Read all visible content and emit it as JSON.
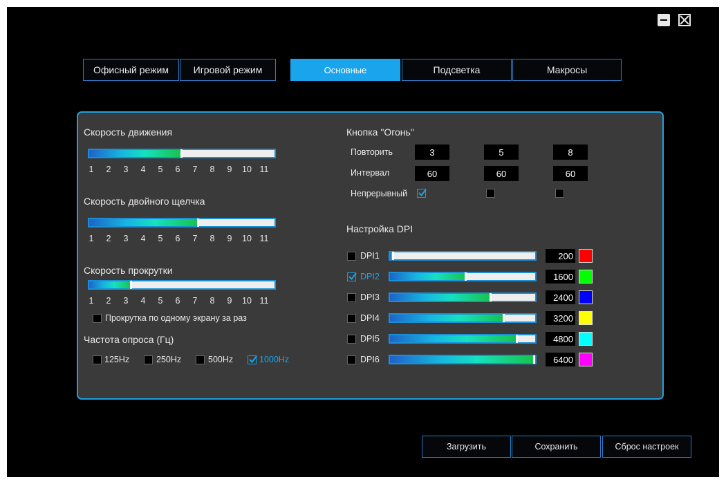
{
  "window": {
    "minimize_icon": "minimize-icon",
    "close_icon": "close-icon"
  },
  "mode_tabs": [
    {
      "label": "Офисный режим"
    },
    {
      "label": "Игровой режим"
    }
  ],
  "section_tabs": [
    {
      "label": "Основные",
      "active": true
    },
    {
      "label": "Подсветка",
      "active": false
    },
    {
      "label": "Макросы",
      "active": false
    }
  ],
  "ticks": [
    "1",
    "2",
    "3",
    "4",
    "5",
    "6",
    "7",
    "8",
    "9",
    "10",
    "11"
  ],
  "movement": {
    "title": "Скорость движения",
    "value": 6
  },
  "double_click": {
    "title": "Скорость двойного щелчка",
    "value": 7
  },
  "scroll": {
    "title": "Скорость прокрутки",
    "value": 3,
    "one_screen_label": "Прокрутка по одному экрану за раз",
    "one_screen_checked": false
  },
  "polling": {
    "title": "Частота опроса (Гц)",
    "options": [
      {
        "label": "125Hz",
        "checked": false
      },
      {
        "label": "250Hz",
        "checked": false
      },
      {
        "label": "500Hz",
        "checked": false
      },
      {
        "label": "1000Hz",
        "checked": true
      }
    ]
  },
  "fire_button": {
    "title": "Кнопка \"Огонь\"",
    "repeat_label": "Повторить",
    "interval_label": "Интервал",
    "continuous_label": "Непрерывный",
    "repeat": [
      "3",
      "5",
      "8"
    ],
    "interval": [
      "60",
      "60",
      "60"
    ],
    "continuous": [
      true,
      false,
      false
    ]
  },
  "dpi": {
    "title": "Настройка DPI",
    "max": 6400,
    "levels": [
      {
        "label": "DPI1",
        "checked": false,
        "value": "200",
        "fraction": 0.03,
        "color": "#ff0000"
      },
      {
        "label": "DPI2",
        "checked": true,
        "value": "1600",
        "fraction": 0.53,
        "color": "#00ff00"
      },
      {
        "label": "DPI3",
        "checked": false,
        "value": "2400",
        "fraction": 0.7,
        "color": "#0000ff"
      },
      {
        "label": "DPI4",
        "checked": false,
        "value": "3200",
        "fraction": 0.79,
        "color": "#ffff00"
      },
      {
        "label": "DPI5",
        "checked": false,
        "value": "4800",
        "fraction": 0.88,
        "color": "#00ffff"
      },
      {
        "label": "DPI6",
        "checked": false,
        "value": "6400",
        "fraction": 1.0,
        "color": "#ff00ff"
      }
    ]
  },
  "footer": {
    "load_label": "Загрузить",
    "save_label": "Сохранить",
    "reset_label": "Сброс настроек"
  },
  "colors": {
    "accent": "#1aa4ec",
    "panel": "#3a3a3a",
    "background": "#000000"
  }
}
